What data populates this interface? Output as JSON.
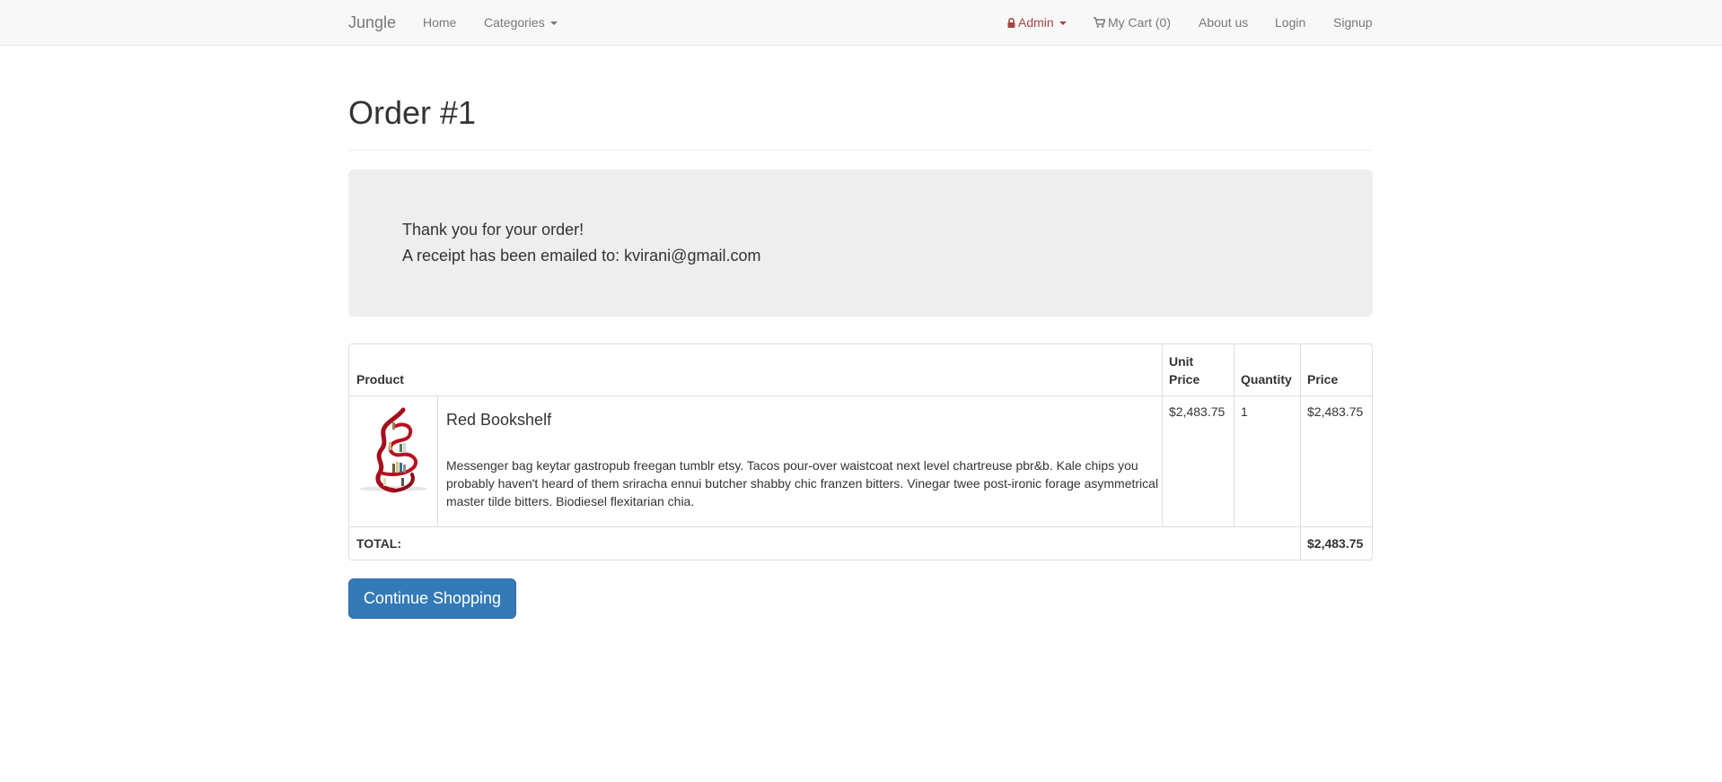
{
  "navbar": {
    "brand": "Jungle",
    "home": "Home",
    "categories": "Categories",
    "admin": "Admin",
    "cart": "My Cart (0)",
    "about": "About us",
    "login": "Login",
    "signup": "Signup"
  },
  "page": {
    "title": "Order #1"
  },
  "jumbotron": {
    "thanks": "Thank you for your order!",
    "receipt": "A receipt has been emailed to: kvirani@gmail.com"
  },
  "table": {
    "headers": {
      "product": "Product",
      "unit_price_1": "Unit",
      "unit_price_2": "Price",
      "quantity": "Quantity",
      "price": "Price"
    },
    "rows": [
      {
        "name": "Red Bookshelf",
        "description": "Messenger bag keytar gastropub freegan tumblr etsy. Tacos pour-over waistcoat next level chartreuse pbr&b. Kale chips you probably haven't heard of them sriracha ennui butcher shabby chic franzen bitters. Vinegar twee post-ironic forage asymmetrical master tilde bitters. Biodiesel flexitarian chia.",
        "unit_price": "$2,483.75",
        "quantity": "1",
        "price": "$2,483.75"
      }
    ],
    "total_label": "TOTAL:",
    "total_value": "$2,483.75"
  },
  "actions": {
    "continue": "Continue Shopping"
  },
  "colors": {
    "navbar_bg": "#f8f8f8",
    "admin_red": "#a94442",
    "primary": "#337ab7",
    "jumbotron_bg": "#eeeeee"
  },
  "icons": {
    "admin": "lock-icon",
    "cart": "shopping-cart-icon"
  }
}
